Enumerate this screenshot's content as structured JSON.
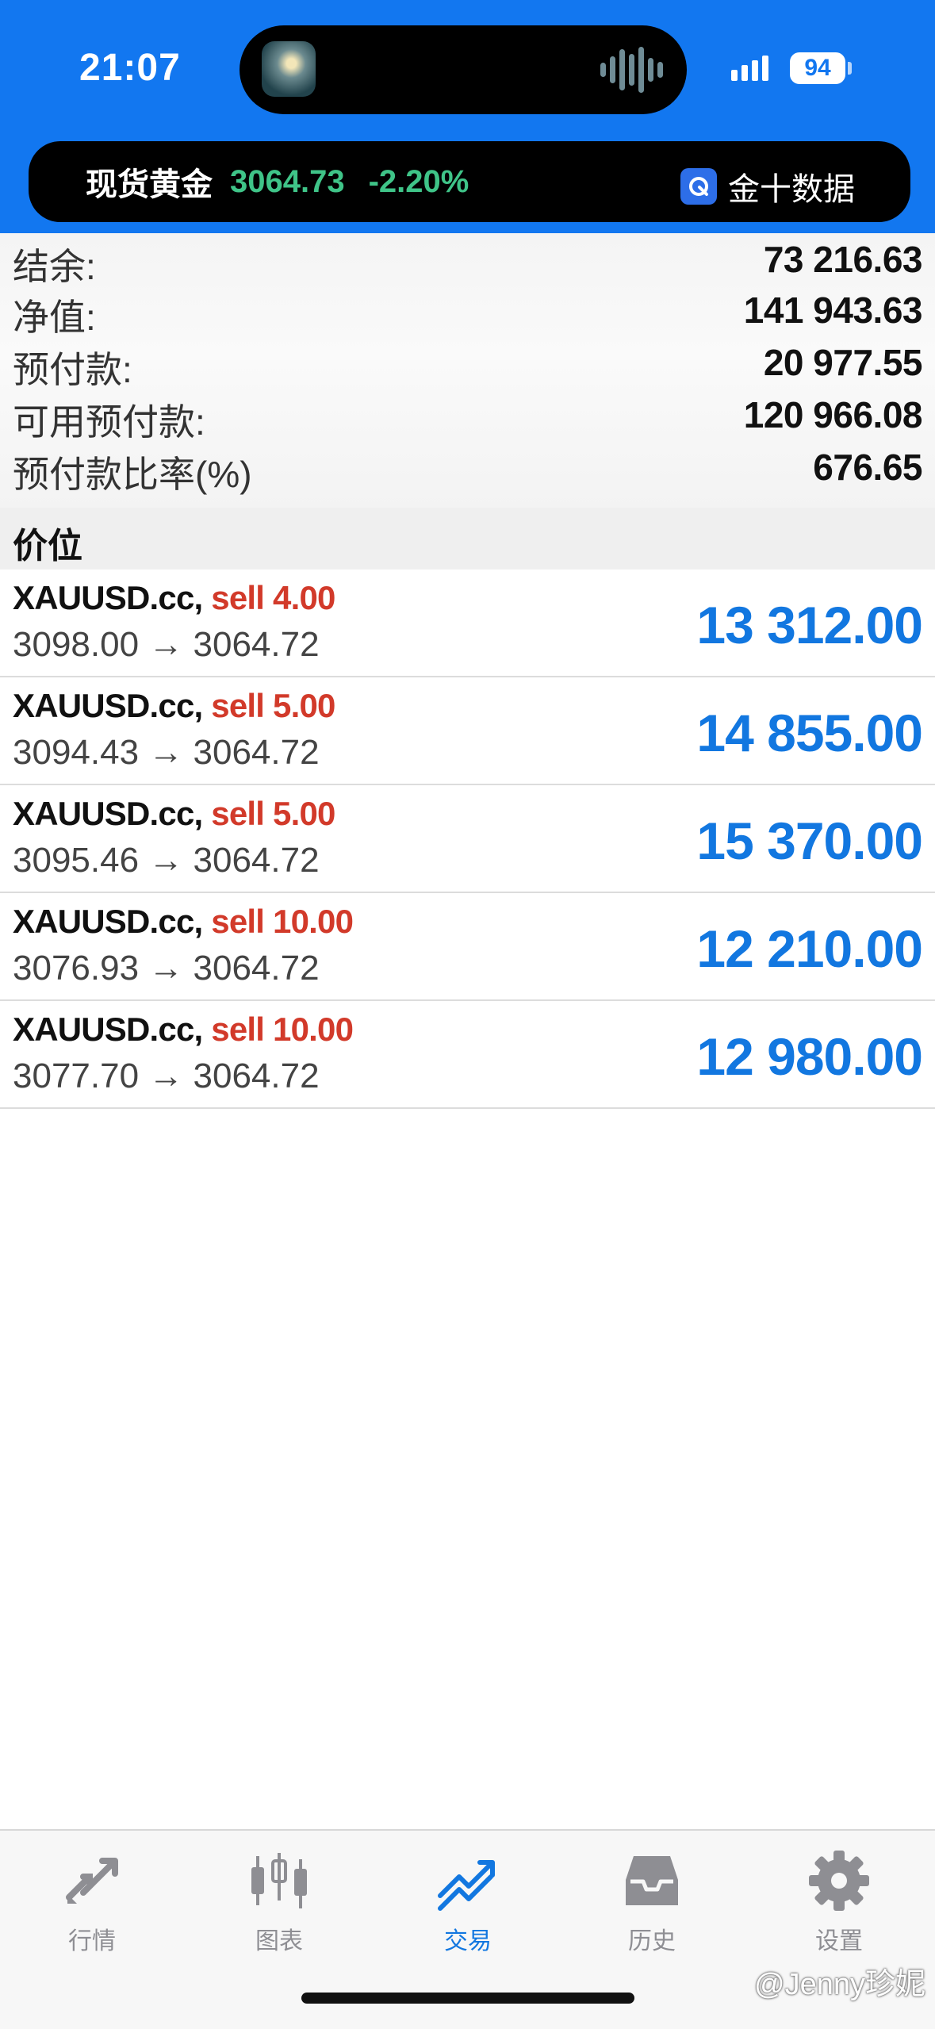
{
  "status_bar": {
    "time": "21:07",
    "battery": "94"
  },
  "ticker": {
    "name": "现货黄金",
    "price": "3064.73",
    "change": "-2.20%",
    "source": "金十数据",
    "price_color": "#3fc488"
  },
  "summary": [
    {
      "label": "结余:",
      "value": "73 216.63"
    },
    {
      "label": "净值:",
      "value": "141 943.63"
    },
    {
      "label": "预付款:",
      "value": "20 977.55"
    },
    {
      "label": "可用预付款:",
      "value": "120 966.08"
    },
    {
      "label": "预付款比率(%)",
      "value": "676.65"
    }
  ],
  "section_title": "价位",
  "positions": [
    {
      "symbol": "XAUUSD.cc,",
      "side": "sell 4.00",
      "prices": "3098.00 → 3064.72",
      "profit": "13 312.00"
    },
    {
      "symbol": "XAUUSD.cc,",
      "side": "sell 5.00",
      "prices": "3094.43 → 3064.72",
      "profit": "14 855.00"
    },
    {
      "symbol": "XAUUSD.cc,",
      "side": "sell 5.00",
      "prices": "3095.46 → 3064.72",
      "profit": "15 370.00"
    },
    {
      "symbol": "XAUUSD.cc,",
      "side": "sell 10.00",
      "prices": "3076.93 → 3064.72",
      "profit": "12 210.00"
    },
    {
      "symbol": "XAUUSD.cc,",
      "side": "sell 10.00",
      "prices": "3077.70 → 3064.72",
      "profit": "12 980.00"
    }
  ],
  "colors": {
    "accent": "#1277f0",
    "sell": "#d23a2a",
    "profit": "#1277e0"
  },
  "tabs": [
    {
      "label": "行情",
      "icon": "quotes-arrows-icon"
    },
    {
      "label": "图表",
      "icon": "candlestick-chart-icon"
    },
    {
      "label": "交易",
      "icon": "trade-trend-icon",
      "active": true
    },
    {
      "label": "历史",
      "icon": "history-tray-icon"
    },
    {
      "label": "设置",
      "icon": "gear-icon"
    }
  ],
  "watermark": "@Jenny珍妮"
}
